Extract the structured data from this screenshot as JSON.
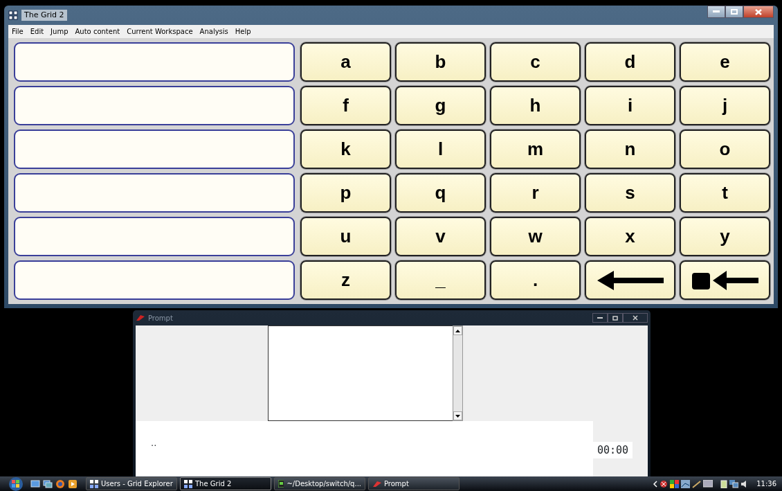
{
  "grid_window": {
    "title": "The Grid 2"
  },
  "menu": [
    "File",
    "Edit",
    "Jump",
    "Auto content",
    "Current Workspace",
    "Analysis",
    "Help"
  ],
  "message_cells": [
    {
      "text": ""
    },
    {
      "text": ""
    },
    {
      "text": ""
    },
    {
      "text": ""
    },
    {
      "text": ""
    },
    {
      "text": ""
    }
  ],
  "keys": [
    {
      "kind": "char",
      "label": "a"
    },
    {
      "kind": "char",
      "label": "b"
    },
    {
      "kind": "char",
      "label": "c"
    },
    {
      "kind": "char",
      "label": "d"
    },
    {
      "kind": "char",
      "label": "e"
    },
    {
      "kind": "char",
      "label": "f"
    },
    {
      "kind": "char",
      "label": "g"
    },
    {
      "kind": "char",
      "label": "h"
    },
    {
      "kind": "char",
      "label": "i"
    },
    {
      "kind": "char",
      "label": "j"
    },
    {
      "kind": "char",
      "label": "k"
    },
    {
      "kind": "char",
      "label": "l"
    },
    {
      "kind": "char",
      "label": "m"
    },
    {
      "kind": "char",
      "label": "n"
    },
    {
      "kind": "char",
      "label": "o"
    },
    {
      "kind": "char",
      "label": "p"
    },
    {
      "kind": "char",
      "label": "q"
    },
    {
      "kind": "char",
      "label": "r"
    },
    {
      "kind": "char",
      "label": "s"
    },
    {
      "kind": "char",
      "label": "t"
    },
    {
      "kind": "char",
      "label": "u"
    },
    {
      "kind": "char",
      "label": "v"
    },
    {
      "kind": "char",
      "label": "w"
    },
    {
      "kind": "char",
      "label": "x"
    },
    {
      "kind": "char",
      "label": "y"
    },
    {
      "kind": "char",
      "label": "z"
    },
    {
      "kind": "char",
      "label": "_"
    },
    {
      "kind": "char",
      "label": "."
    },
    {
      "kind": "backspace"
    },
    {
      "kind": "clear"
    }
  ],
  "prompt_window": {
    "title": "Prompt",
    "output": "..",
    "timer": "00:00"
  },
  "taskbar": {
    "tasks": [
      {
        "label": "Users - Grid Explorer",
        "selected": false,
        "kind": "grid"
      },
      {
        "label": "The Grid 2",
        "selected": true,
        "kind": "grid"
      },
      {
        "label": "~/Desktop/switch/q...",
        "selected": false,
        "kind": "terminal"
      },
      {
        "label": "Prompt",
        "selected": false,
        "kind": "tk"
      }
    ],
    "clock": "11:36"
  }
}
